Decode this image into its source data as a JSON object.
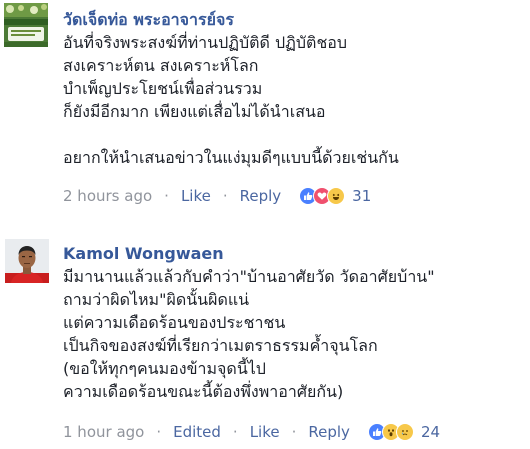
{
  "comments": [
    {
      "author": "วัดเจ็ดท่อ พระอาจารย์จร",
      "lines": [
        "อันที่จริงพระสงฆ์ที่ท่านปฏิบัติดี ปฏิบัติชอบ",
        "สงเคราะห์ตน สงเคราะห์โลก",
        "บำเพ็ญประโยชน์เพื่อส่วนรวม",
        "ก็ยังมีอีกมาก เพียงแต่เสื่อไม่ได้นำเสนอ",
        "",
        "อยากให้นำเสนอข่าวในแง่มุมดีๆแบบนี้ด้วยเช่นกัน"
      ],
      "time": "2 hours ago",
      "like_label": "Like",
      "reply_label": "Reply",
      "reactions": [
        "like-reaction-icon",
        "love-reaction-icon",
        "haha-reaction-icon"
      ],
      "reaction_count": "31"
    },
    {
      "author": "Kamol Wongwaen",
      "lines": [
        "มีมานานแล้วแล้วกับคำว่า\"บ้านอาศัยวัด วัดอาศัยบ้าน\"",
        "ถามว่าผิดไหม\"ผิดนั้นผิดแน่",
        "แต่ความเดือดร้อนของประชาชน",
        "เป็นกิจของสงฆ์ที่เรียกว่าเมตราธรรมค้ำจุนโลก",
        "(ขอให้ทุกๆคนมองข้ามจุดนี้ไป",
        "ความเดือดร้อนขณะนี้ต้องพึ่งพาอาศัยกัน)"
      ],
      "time": "1 hour ago",
      "edited_label": "Edited",
      "like_label": "Like",
      "reply_label": "Reply",
      "reactions": [
        "like-reaction-icon",
        "wow-reaction-icon",
        "sad-reaction-icon"
      ],
      "reaction_count": "24"
    }
  ],
  "colors": {
    "author": "#365899",
    "meta": "#90949c",
    "action": "#4b67a1",
    "text": "#1d2129"
  }
}
